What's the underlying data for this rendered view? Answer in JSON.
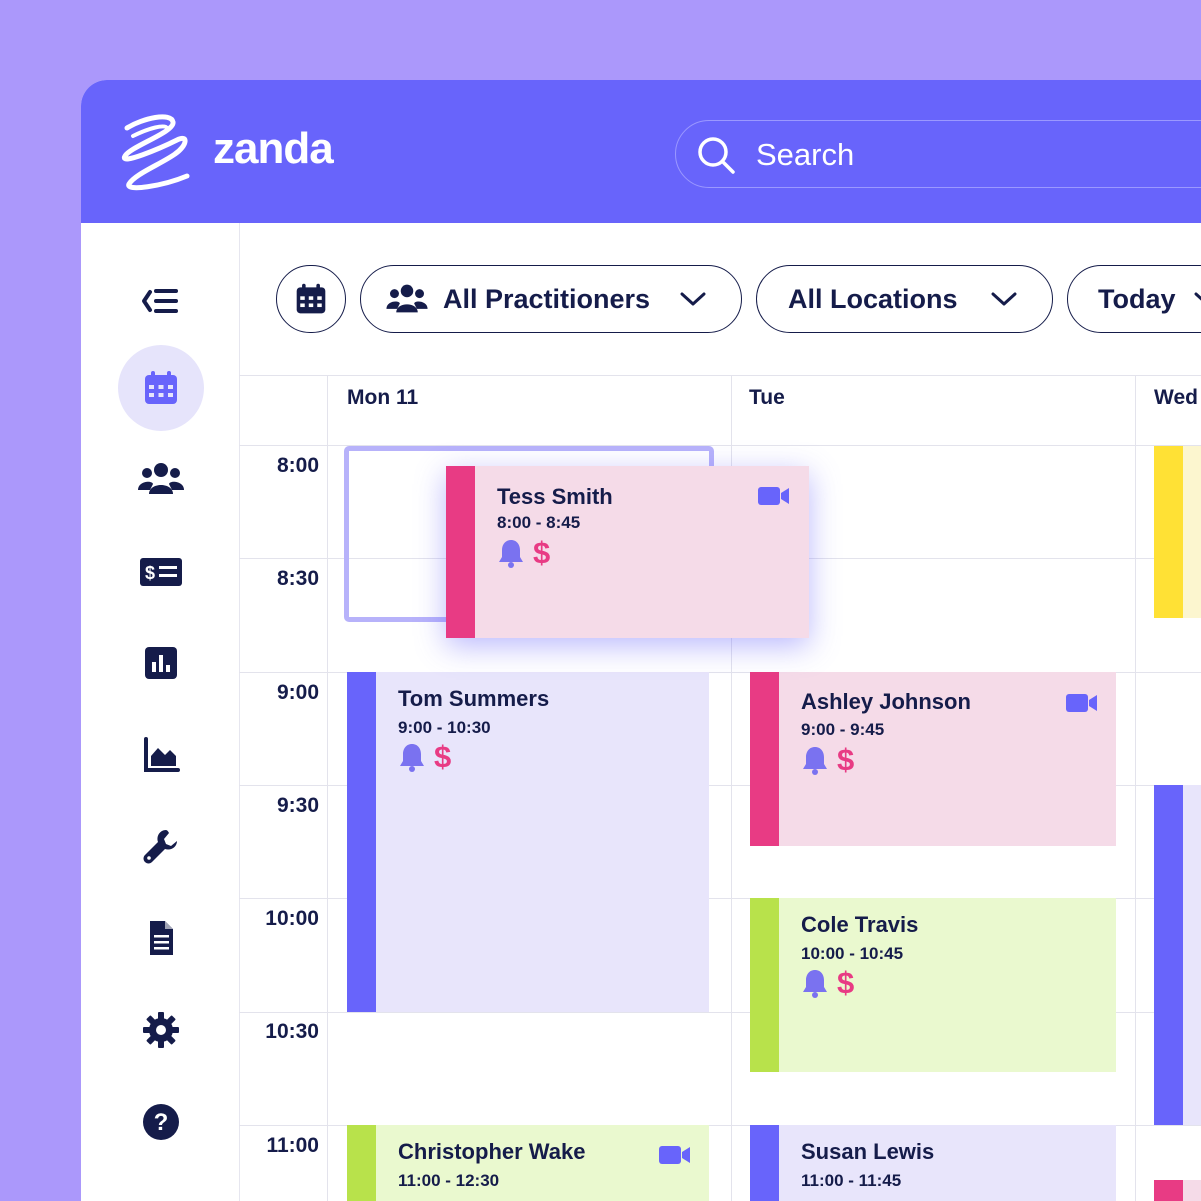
{
  "app": {
    "name": "zanda"
  },
  "search": {
    "placeholder": "Search"
  },
  "sidebar": {
    "items": [
      {
        "id": "collapse",
        "icon": "collapse-menu-icon"
      },
      {
        "id": "calendar",
        "icon": "calendar-icon",
        "active": true
      },
      {
        "id": "clients",
        "icon": "users-icon"
      },
      {
        "id": "billing",
        "icon": "invoice-icon"
      },
      {
        "id": "reports",
        "icon": "bar-chart-icon"
      },
      {
        "id": "analytics",
        "icon": "area-chart-icon"
      },
      {
        "id": "tools",
        "icon": "wrench-icon"
      },
      {
        "id": "documents",
        "icon": "document-icon"
      },
      {
        "id": "settings",
        "icon": "gear-icon"
      },
      {
        "id": "help",
        "icon": "help-icon"
      }
    ]
  },
  "toolbar": {
    "practitioners": "All Practitioners",
    "locations": "All Locations",
    "today": "Today"
  },
  "calendar": {
    "days": [
      "Mon 11",
      "Tue",
      "Wed"
    ],
    "times": [
      "8:00",
      "8:30",
      "9:00",
      "9:30",
      "10:00",
      "10:30",
      "11:00"
    ]
  },
  "appointments": {
    "tess": {
      "name": "Tess Smith",
      "time": "8:00 - 8:45",
      "video": true
    },
    "tom": {
      "name": "Tom Summers",
      "time": "9:00 - 10:30",
      "video": false
    },
    "ashley": {
      "name": "Ashley Johnson",
      "time": "9:00 - 9:45",
      "video": true
    },
    "cole": {
      "name": "Cole Travis",
      "time": "10:00 - 10:45",
      "video": false
    },
    "christopher": {
      "name": "Christopher Wake",
      "time": "11:00 - 12:30",
      "video": true
    },
    "susan": {
      "name": "Susan Lewis",
      "time": "11:00 - 11:45",
      "video": false
    }
  },
  "colors": {
    "brand": "#6864fb",
    "pink_accent": "#e83b84",
    "lavender_accent": "#6864fb",
    "lime_accent": "#b8e24b",
    "yellow_accent": "#ffe135",
    "navy": "#151c4a"
  }
}
